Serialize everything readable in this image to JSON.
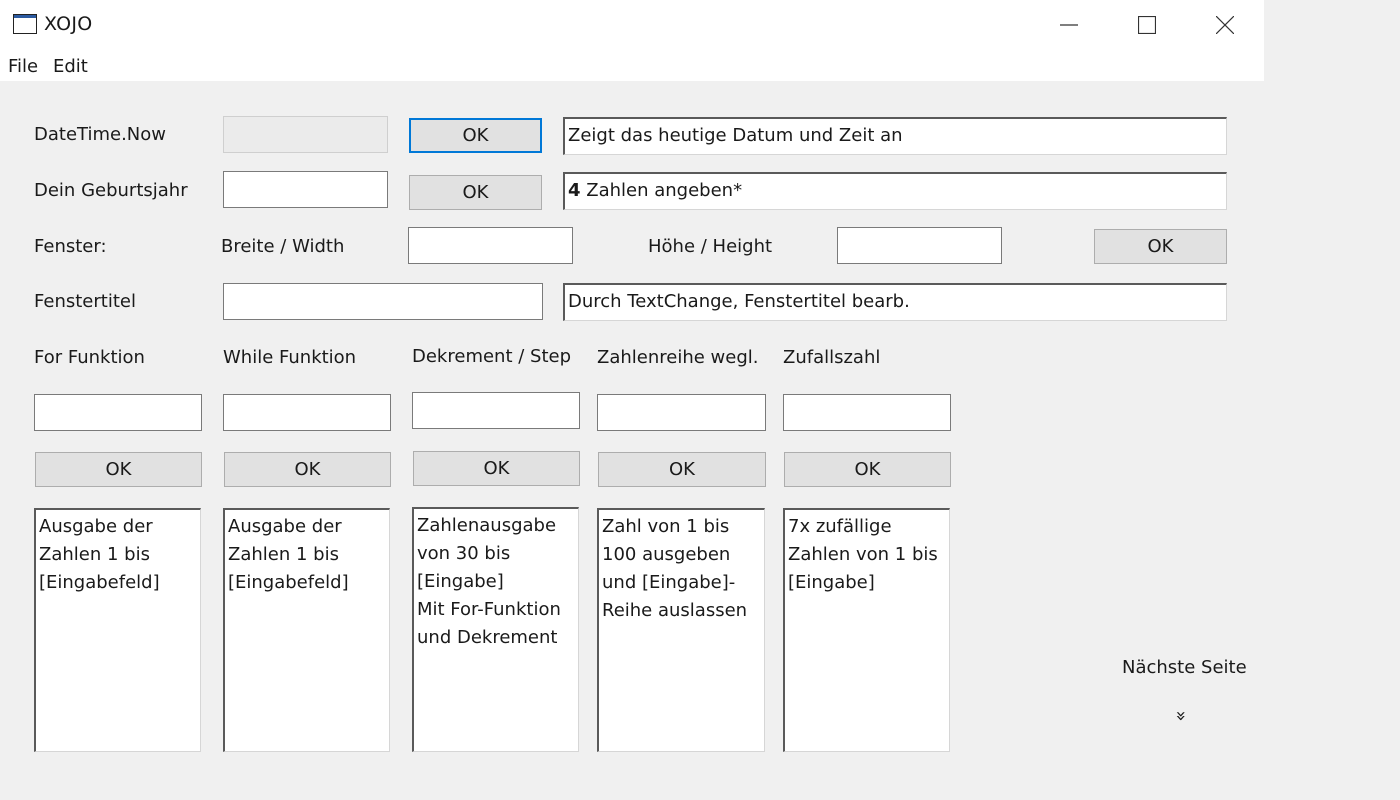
{
  "window": {
    "title": "XOJO",
    "icon": "app-window-icon",
    "controls": {
      "minimize": "minimize-icon",
      "maximize": "maximize-icon",
      "close": "close-icon"
    }
  },
  "menu": {
    "file": "File",
    "edit": "Edit"
  },
  "row1": {
    "label": "DateTime.Now",
    "value": "",
    "button": "OK",
    "info": "Zeigt das heutige Datum und Zeit an"
  },
  "row2": {
    "label": "Dein Geburtsjahr",
    "value": "",
    "button": "OK",
    "info_bold": "4",
    "info_rest": " Zahlen angeben*"
  },
  "row3": {
    "label": "Fenster:",
    "width_label": "Breite / Width",
    "width_value": "",
    "height_label": "Höhe / Height",
    "height_value": "",
    "button": "OK"
  },
  "row4": {
    "label": "Fenstertitel",
    "value": "",
    "info": "Durch TextChange, Fenstertitel bearb."
  },
  "columns": [
    {
      "label": "For Funktion",
      "input": "",
      "button": "OK",
      "output": "Ausgabe der\nZahlen 1 bis\n[Eingabefeld]"
    },
    {
      "label": "While Funktion",
      "input": "",
      "button": "OK",
      "output": "Ausgabe der\nZahlen 1 bis\n[Eingabefeld]"
    },
    {
      "label": "Dekrement / Step",
      "input": "",
      "button": "OK",
      "output": "Zahlenausgabe\nvon 30 bis\n[Eingabe]\nMit For-Funktion\nund Dekrement"
    },
    {
      "label": "Zahlenreihe wegl.",
      "input": "",
      "button": "OK",
      "output": "Zahl von 1 bis\n100  ausgeben\nund [Eingabe]-\nReihe auslassen"
    },
    {
      "label": "Zufallszahl",
      "input": "",
      "button": "OK",
      "output": "7x zufällige\nZahlen von 1 bis\n[Eingabe]"
    }
  ],
  "next_page": {
    "label": "Nächste Seite",
    "icon": "double-chevron-down-icon",
    "glyph": "»"
  }
}
